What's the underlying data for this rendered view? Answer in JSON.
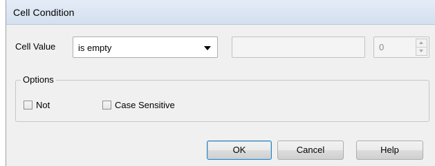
{
  "window": {
    "title": "Cell Condition"
  },
  "condition": {
    "label": "Cell Value",
    "operator_value": "is empty",
    "value1": "",
    "value2": "0"
  },
  "options": {
    "legend": "Options",
    "not_label": "Not",
    "not_checked": false,
    "case_label": "Case Sensitive",
    "case_checked": false
  },
  "buttons": {
    "ok": "OK",
    "cancel": "Cancel",
    "help": "Help"
  }
}
